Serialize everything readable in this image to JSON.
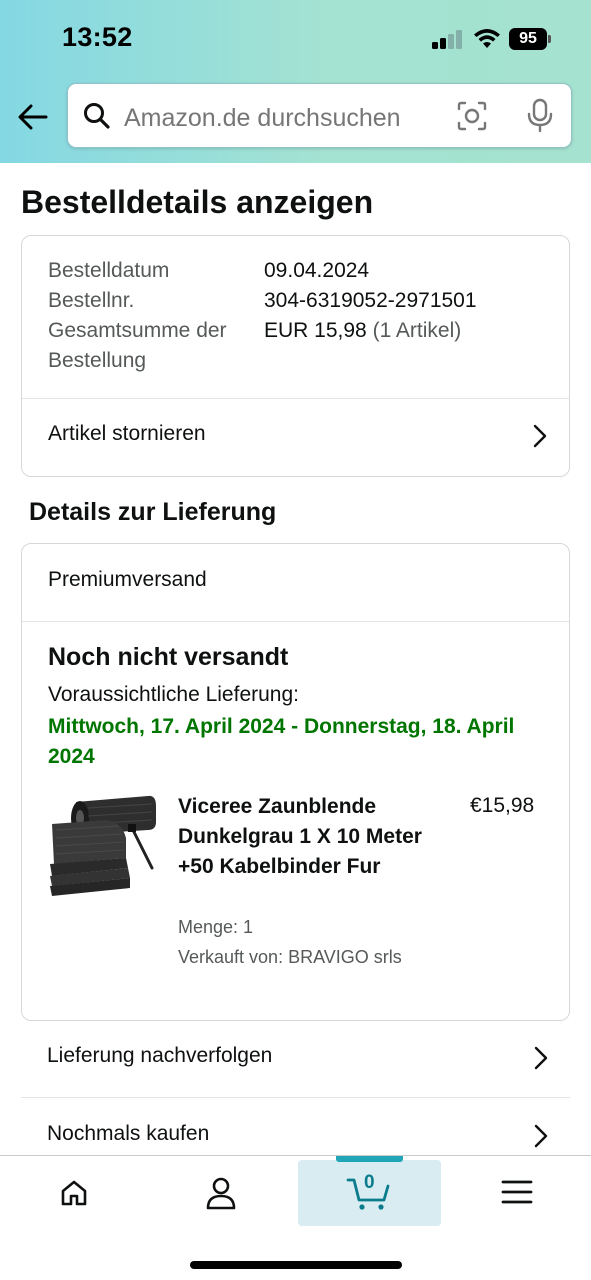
{
  "status_bar": {
    "time": "13:52",
    "battery": "95"
  },
  "search": {
    "placeholder": "Amazon.de durchsuchen"
  },
  "page": {
    "title": "Bestelldetails anzeigen"
  },
  "order_summary": {
    "rows": [
      {
        "label": "Bestelldatum",
        "value": "09.04.2024"
      },
      {
        "label": "Bestellnr.",
        "value": "304-6319052-2971501"
      },
      {
        "label": "Gesamtsumme der Bestellung",
        "value": "EUR 15,98",
        "value_note": "(1 Artikel)"
      }
    ],
    "cancel_label": "Artikel stornieren"
  },
  "delivery": {
    "section_title": "Details zur Lieferung",
    "shipping_method": "Premiumversand",
    "status": "Noch nicht versandt",
    "expected_label": "Voraussichtliche Lieferung:",
    "expected_dates": "Mittwoch, 17. April 2024 - Donnerstag, 18. April 2024",
    "item": {
      "title": "Viceree Zaunblende Dunkelgrau 1 X 10 Meter +50 Kabelbinder Fur",
      "price": "€15,98",
      "quantity": "Menge: 1",
      "seller": "Verkauft von: BRAVIGO srls"
    }
  },
  "actions": [
    {
      "label": "Lieferung nachverfolgen"
    },
    {
      "label": "Nochmals kaufen"
    }
  ],
  "bottom_nav": {
    "cart_count": "0",
    "active": "cart",
    "accent_color": "#21a5b9"
  },
  "colors": {
    "delivery_green": "#007600",
    "header_gradient_start": "#84d8e3",
    "header_gradient_end": "#a5e2cf"
  }
}
